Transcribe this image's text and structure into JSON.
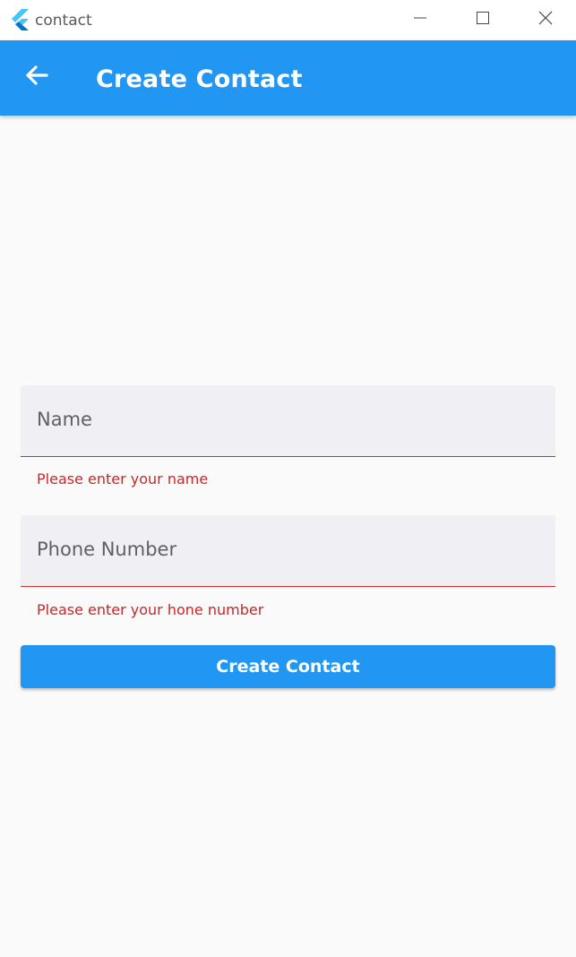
{
  "window": {
    "app_name": "contact",
    "icon": "flutter-logo-icon",
    "controls": [
      "minimize-icon",
      "maximize-icon",
      "close-icon"
    ]
  },
  "appbar": {
    "back_icon": "arrow-back-icon",
    "title": "Create Contact",
    "color": "#2196f3"
  },
  "form": {
    "name": {
      "label": "Name",
      "value": "",
      "error": "Please enter your name"
    },
    "phone": {
      "label": "Phone Number",
      "value": "",
      "error": "Please enter your hone number"
    },
    "submit_label": "Create Contact",
    "error_color": "#c62828"
  }
}
